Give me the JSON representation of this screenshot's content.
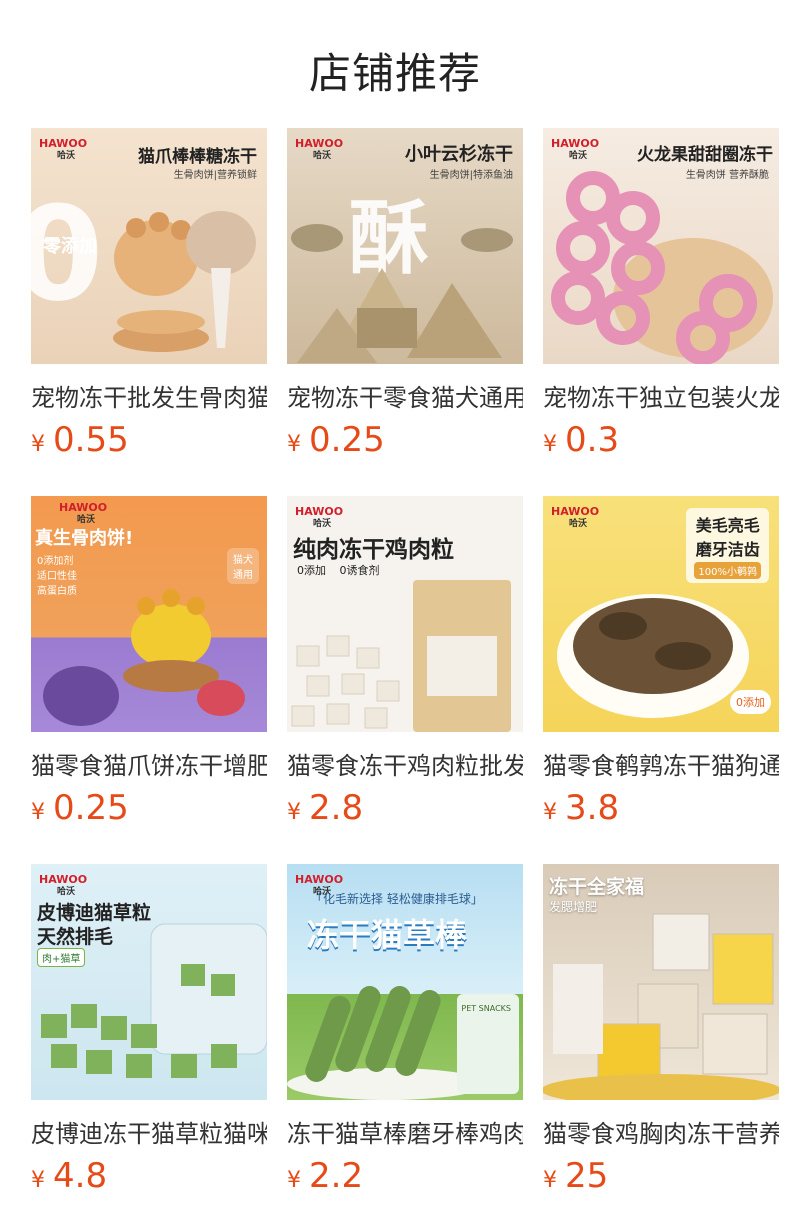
{
  "header": {
    "title": "店铺推荐"
  },
  "logo": {
    "en": "HAWOO",
    "cn": "哈沃"
  },
  "products": [
    {
      "name": "宠物冻干批发生骨肉猫",
      "currency": "¥",
      "price": "0.55",
      "image_text": {
        "headline": "猫爪棒棒糖冻干",
        "sub": "生骨肉饼|营养锁鲜",
        "badge": "零添加",
        "big": "0"
      },
      "bg": "#f2dcc4"
    },
    {
      "name": "宠物冻干零食猫犬通用",
      "currency": "¥",
      "price": "0.25",
      "image_text": {
        "headline": "小叶云杉冻干",
        "sub": "生骨肉饼|特添鱼油",
        "big": "酥"
      },
      "bg": "#d8c9b2"
    },
    {
      "name": "宠物冻干独立包装火龙",
      "currency": "¥",
      "price": "0.3",
      "image_text": {
        "headline": "火龙果甜甜圈冻干",
        "sub": "生骨肉饼 营养酥脆"
      },
      "bg": "#f3e6da"
    },
    {
      "name": "猫零食猫爪饼冻干增肥",
      "currency": "¥",
      "price": "0.25",
      "image_text": {
        "headline": "真生骨肉饼!",
        "points": [
          "0添加剂",
          "适口性佳",
          "高蛋白质"
        ],
        "tag": "猫犬通用"
      },
      "bg": "#f0a15a"
    },
    {
      "name": "猫零食冻干鸡肉粒批发",
      "currency": "¥",
      "price": "2.8",
      "image_text": {
        "headline": "纯肉冻干鸡肉粒",
        "tags": [
          "0添加",
          "0诱食剂"
        ]
      },
      "bg": "#f4f1ec"
    },
    {
      "name": "猫零食鹌鹑冻干猫狗通用",
      "currency": "¥",
      "price": "3.8",
      "image_text": {
        "headline1": "美毛亮毛",
        "headline2": "磨牙洁齿",
        "tag": "100%小鹌鹑",
        "badge": "0添加"
      },
      "bg": "#f7dd6c"
    },
    {
      "name": "皮博迪冻干猫草粒猫咪",
      "currency": "¥",
      "price": "4.8",
      "image_text": {
        "headline1": "皮博迪猫草粒",
        "headline2": "天然排毛",
        "tag": "肉+猫草"
      },
      "bg": "#d9ecf4"
    },
    {
      "name": "冻干猫草棒磨牙棒鸡肉",
      "currency": "¥",
      "price": "2.2",
      "image_text": {
        "top": "「化毛新选择 轻松健康排毛球」",
        "headline": "冻干猫草棒",
        "pack": "PET SNACKS"
      },
      "bg": "#bfe2f3"
    },
    {
      "name": "猫零食鸡胸肉冻干营养",
      "currency": "¥",
      "price": "25",
      "image_text": {
        "headline": "冻干全家福",
        "sub": "发腮增肥"
      },
      "bg": "#e8ded0"
    }
  ]
}
